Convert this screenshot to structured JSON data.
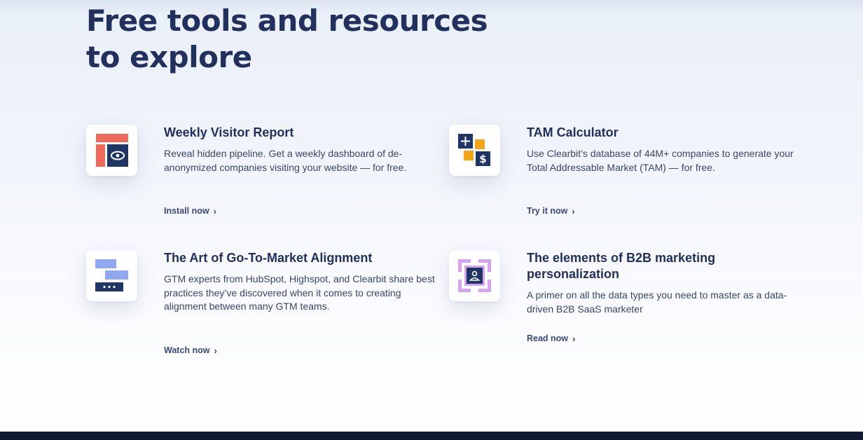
{
  "section": {
    "title_line1": "Free tools and resources",
    "title_line2": "to explore"
  },
  "cards": [
    {
      "icon": "visitor-report-icon",
      "title": "Weekly Visitor Report",
      "description": "Reveal hidden pipeline. Get a weekly dashboard of de-anonymized companies visiting your website — for free.",
      "link_label": "Install now"
    },
    {
      "icon": "tam-calculator-icon",
      "title": "TAM Calculator",
      "description": "Use Clearbit’s database of 44M+ companies to generate your Total Addressable Market (TAM) — for free.",
      "link_label": "Try it now"
    },
    {
      "icon": "gtm-alignment-icon",
      "title": "The Art of Go-To-Market Alignment",
      "description": "GTM experts from HubSpot, Highspot, and Clearbit share best practices they’ve discovered when it comes to creating alignment between many GTM teams.",
      "link_label": "Watch now"
    },
    {
      "icon": "b2b-personalization-icon",
      "title": "The elements of B2B marketing personalization",
      "description": "A primer on all the data types you need to master as a data-driven B2B SaaS marketer",
      "link_label": "Read now"
    }
  ],
  "colors": {
    "heading": "#22305e",
    "accent_red": "#ef6a5a",
    "accent_orange": "#f6a419",
    "accent_blue_light": "#8fa8f0",
    "accent_purple": "#d7a3f0",
    "navy": "#1e3566",
    "footer": "#101a33"
  }
}
